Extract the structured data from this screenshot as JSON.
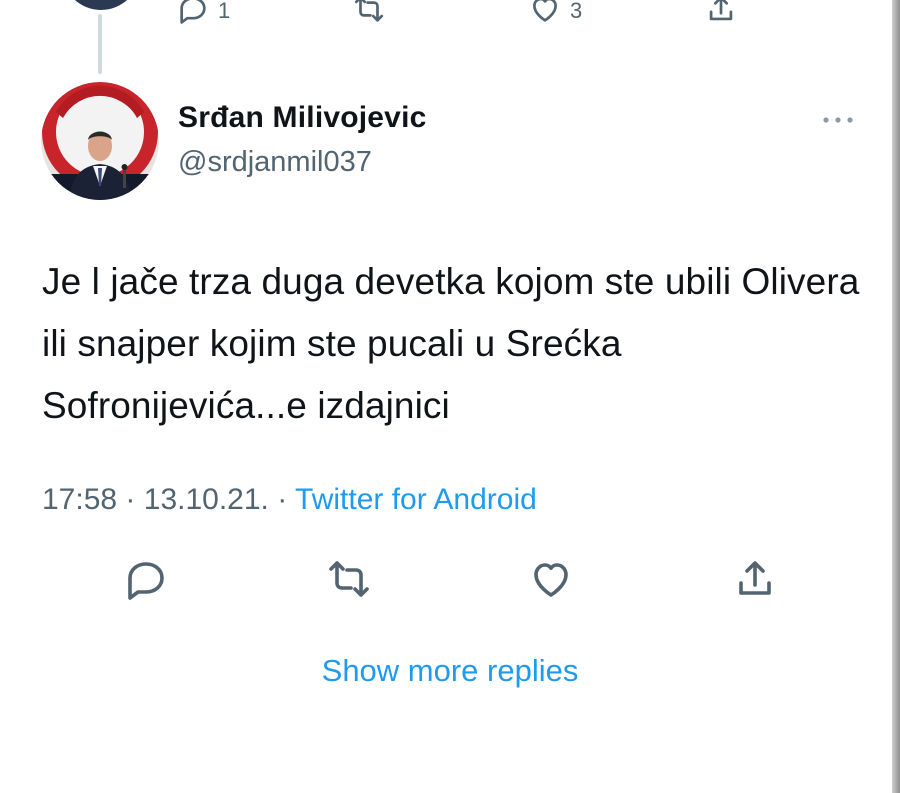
{
  "previous_tweet": {
    "reply_count": "1",
    "retweet_count": "",
    "like_count": "3",
    "icons": [
      "reply-icon",
      "retweet-icon",
      "like-icon",
      "share-icon"
    ]
  },
  "tweet": {
    "display_name": "Srđan Milivojevic",
    "handle": "@srdjanmil037",
    "text": "Je l jače trza duga devetka kojom ste ubili Olivera ili snajper kojim ste pucali u Srećka Sofronijevića...e izdajnici",
    "time": "17:58",
    "date": "13.10.21.",
    "separator": "·",
    "source": "Twitter for Android",
    "icons": [
      "reply-icon",
      "retweet-icon",
      "like-icon",
      "share-icon",
      "more-icon"
    ]
  },
  "show_more_replies": "Show more replies",
  "colors": {
    "link_blue": "#1d9bf0",
    "secondary_text": "#536471",
    "primary_text": "#0f1419",
    "thread_line": "#cfd9de"
  }
}
